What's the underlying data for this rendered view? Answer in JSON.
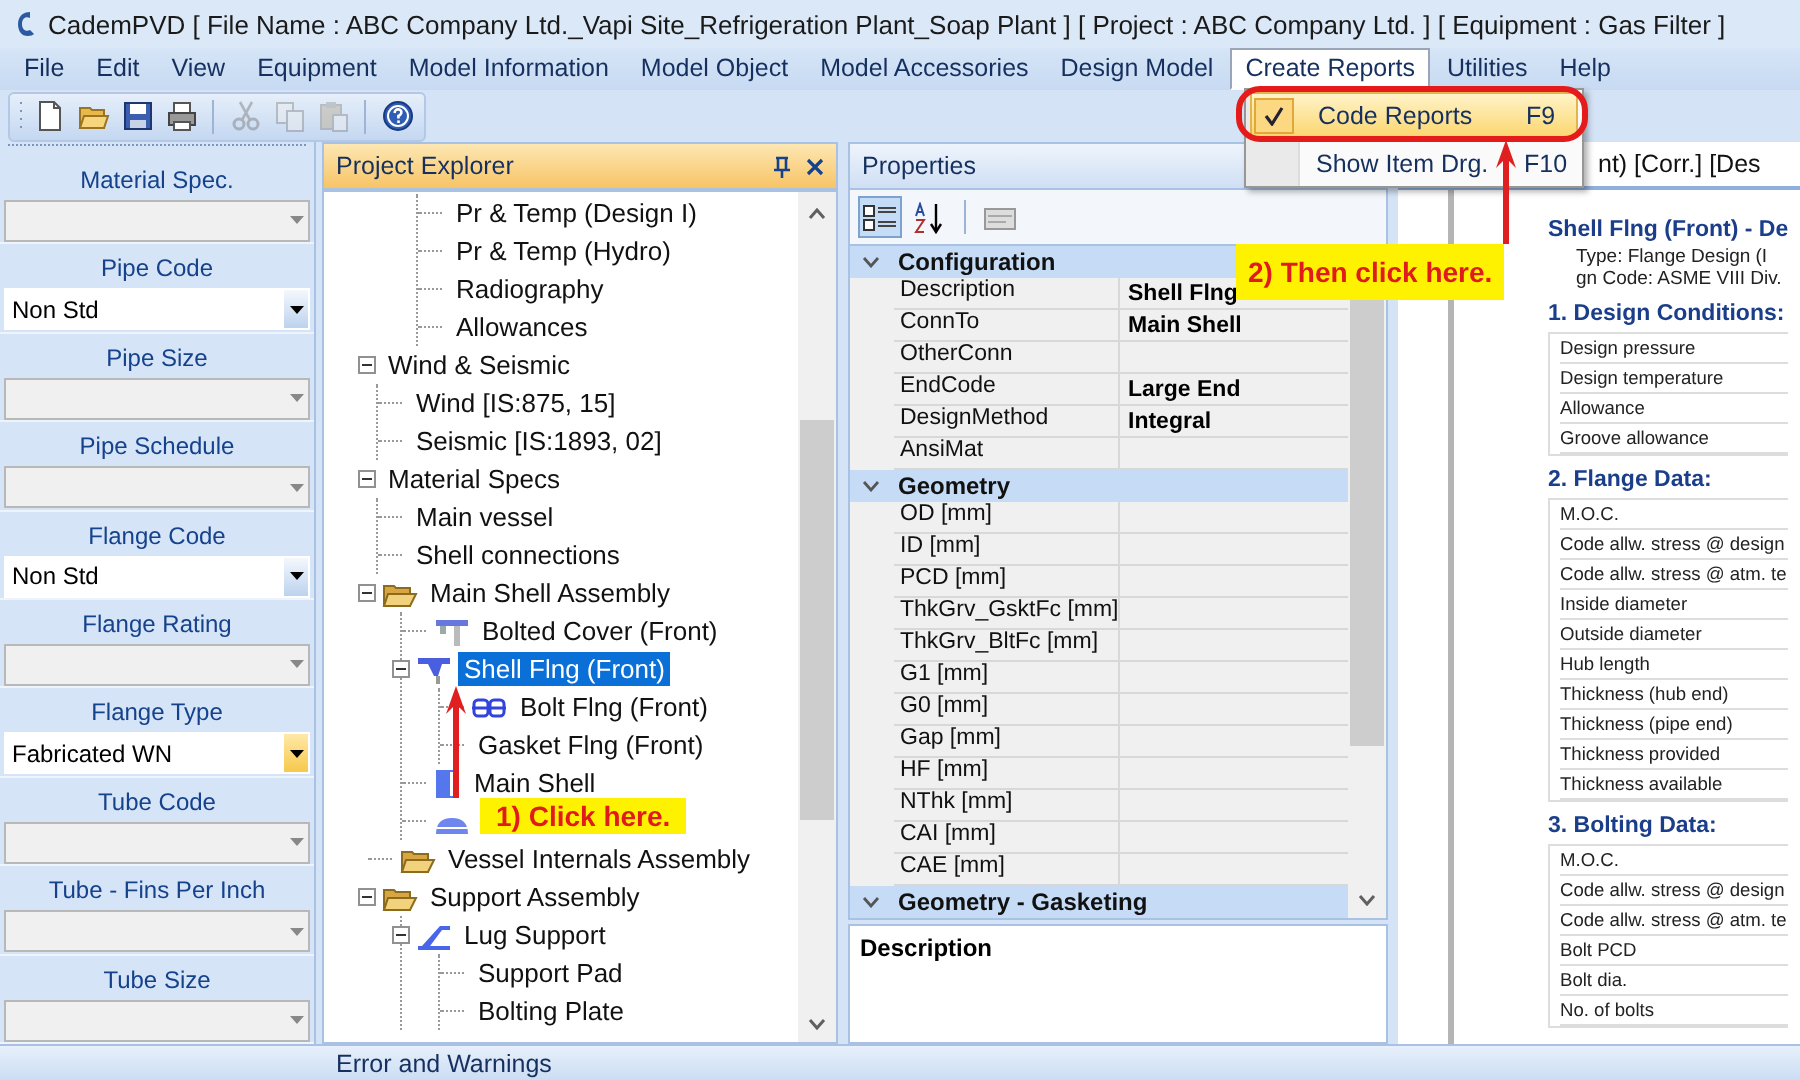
{
  "window": {
    "title": "CademPVD [ File Name : ABC Company Ltd._Vapi Site_Refrigeration Plant_Soap Plant ] [ Project : ABC Company Ltd. ] [ Equipment : Gas Filter ]"
  },
  "menu": [
    {
      "label": "File",
      "selected": false
    },
    {
      "label": "Edit",
      "selected": false
    },
    {
      "label": "View",
      "selected": false
    },
    {
      "label": "Equipment",
      "selected": false
    },
    {
      "label": "Model Information",
      "selected": false
    },
    {
      "label": "Model Object",
      "selected": false
    },
    {
      "label": "Model Accessories",
      "selected": false
    },
    {
      "label": "Design Model",
      "selected": false
    },
    {
      "label": "Create Reports",
      "selected": true
    },
    {
      "label": "Utilities",
      "selected": false
    },
    {
      "label": "Help",
      "selected": false
    }
  ],
  "dropdown": [
    {
      "label": "Code Reports",
      "shortcut": "F9",
      "checked": true,
      "highlighted": true
    },
    {
      "label": "Show Item Drg.",
      "shortcut": "F10",
      "checked": false,
      "highlighted": false
    }
  ],
  "toolbar": [
    {
      "kind": "new",
      "disabled": false
    },
    {
      "kind": "open",
      "disabled": false
    },
    {
      "kind": "save",
      "disabled": false
    },
    {
      "kind": "print",
      "disabled": false
    },
    {
      "kind": "sep"
    },
    {
      "kind": "cut",
      "disabled": true
    },
    {
      "kind": "copy",
      "disabled": true
    },
    {
      "kind": "paste",
      "disabled": true
    },
    {
      "kind": "sep"
    },
    {
      "kind": "help",
      "disabled": false
    }
  ],
  "side_fields": [
    {
      "label": "Material Spec.",
      "enabled": false,
      "active": false
    },
    {
      "label": "Pipe Code",
      "value": "Non Std",
      "enabled": true,
      "active": false
    },
    {
      "label": "Pipe Size",
      "enabled": false,
      "active": false
    },
    {
      "label": "Pipe Schedule",
      "enabled": false,
      "active": false
    },
    {
      "label": "Flange Code",
      "value": "Non Std",
      "enabled": true,
      "active": false
    },
    {
      "label": "Flange Rating",
      "enabled": false,
      "active": false
    },
    {
      "label": "Flange Type",
      "value": "Fabricated WN",
      "enabled": true,
      "active": true
    },
    {
      "label": "Tube Code",
      "enabled": false,
      "active": false
    },
    {
      "label": "Tube - Fins Per Inch",
      "enabled": false,
      "active": false
    },
    {
      "label": "Tube Size",
      "enabled": false,
      "active": false
    }
  ],
  "explorer": {
    "title": "Project Explorer",
    "items": [
      {
        "kind": "scrolled",
        "children": [
          {
            "label": "Pr & Temp (Design I)",
            "selected": false
          },
          {
            "label": "Pr & Temp (Hydro)",
            "selected": false
          },
          {
            "label": "Radiography",
            "selected": false
          },
          {
            "label": "Allowances",
            "selected": false
          }
        ]
      },
      {
        "label": "Wind & Seismic",
        "selected": false,
        "expanded": true,
        "children": [
          {
            "label": "Wind [IS:875, 15]",
            "selected": false
          },
          {
            "label": "Seismic [IS:1893, 02]",
            "selected": false
          }
        ]
      },
      {
        "label": "Material Specs",
        "selected": false,
        "expanded": true,
        "children": [
          {
            "label": "Main vessel",
            "selected": false
          },
          {
            "label": "Shell connections",
            "selected": false
          }
        ]
      },
      {
        "label": "Main Shell Assembly",
        "kind": "folder",
        "selected": false,
        "expanded": true,
        "children": [
          {
            "label": "Bolted Cover (Front)",
            "kind": "cover",
            "selected": false
          },
          {
            "label": "Shell Flng (Front)",
            "kind": "flange",
            "selected": true,
            "expanded": true,
            "children": [
              {
                "label": "Bolt Flng (Front)",
                "kind": "bolt",
                "selected": false
              },
              {
                "label": "Gasket Flng (Front)",
                "selected": false
              }
            ]
          },
          {
            "label": "Main Shell",
            "kind": "shell",
            "selected": false
          },
          {
            "kind": "dome"
          }
        ]
      },
      {
        "label": "Vessel Internals Assembly",
        "kind": "folder",
        "selected": false
      },
      {
        "label": "Support Assembly",
        "kind": "folder",
        "selected": false,
        "expanded": true,
        "children": [
          {
            "label": "Lug Support",
            "kind": "lug",
            "selected": false,
            "expanded": true,
            "children": [
              {
                "label": "Support Pad",
                "selected": false
              },
              {
                "label": "Bolting Plate",
                "selected": false
              }
            ]
          }
        ]
      }
    ]
  },
  "properties": {
    "title": "Properties",
    "categories": [
      {
        "label": "Configuration",
        "expanded": true,
        "rows": [
          {
            "name": "Description",
            "value": "Shell Flng"
          },
          {
            "name": "ConnTo",
            "value": "Main Shell"
          },
          {
            "name": "OtherConn"
          },
          {
            "name": "EndCode",
            "value": "Large End"
          },
          {
            "name": "DesignMethod",
            "value": "Integral"
          },
          {
            "name": "AnsiMat"
          }
        ]
      },
      {
        "label": "Geometry",
        "expanded": true,
        "rows": [
          {
            "name": "OD [mm]"
          },
          {
            "name": "ID [mm]"
          },
          {
            "name": "PCD [mm]"
          },
          {
            "name": "ThkGrv_GsktFc [mm]"
          },
          {
            "name": "ThkGrv_BltFc [mm]"
          },
          {
            "name": "G1 [mm]"
          },
          {
            "name": "G0 [mm]"
          },
          {
            "name": "Gap [mm]"
          },
          {
            "name": "HF [mm]"
          },
          {
            "name": "NThk [mm]"
          },
          {
            "name": "CAI [mm]"
          },
          {
            "name": "CAE [mm]"
          }
        ]
      },
      {
        "label": "Geometry - Gasketing",
        "expanded": true
      }
    ],
    "description_title": "Description"
  },
  "report": {
    "header": "nt) [Corr.] [Des",
    "title": "Shell Flng (Front) - De",
    "lines": [
      "Type: Flange Design (I",
      "gn Code: ASME VIII Div."
    ],
    "sections": [
      {
        "heading": "1. Design Conditions:",
        "rows": [
          "Design pressure",
          "Design temperature",
          "Allowance",
          "Groove allowance"
        ]
      },
      {
        "heading": "2. Flange Data:",
        "rows": [
          "M.O.C.",
          "Code allw. stress @ design",
          "Code allw. stress @ atm. te",
          "Inside diameter",
          "Outside diameter",
          "Hub length",
          "Thickness (hub end)",
          "Thickness (pipe end)",
          "Thickness provided",
          "Thickness available"
        ]
      },
      {
        "heading": "3. Bolting Data:",
        "rows": [
          "M.O.C.",
          "Code allw. stress @ design",
          "Code allw. stress @ atm. te",
          "Bolt PCD",
          "Bolt dia.",
          "No. of bolts"
        ]
      }
    ]
  },
  "bottom_panel": {
    "title": "Error and Warnings"
  },
  "callouts": [
    {
      "text": "1) Click here."
    },
    {
      "text": "2) Then click here."
    }
  ]
}
